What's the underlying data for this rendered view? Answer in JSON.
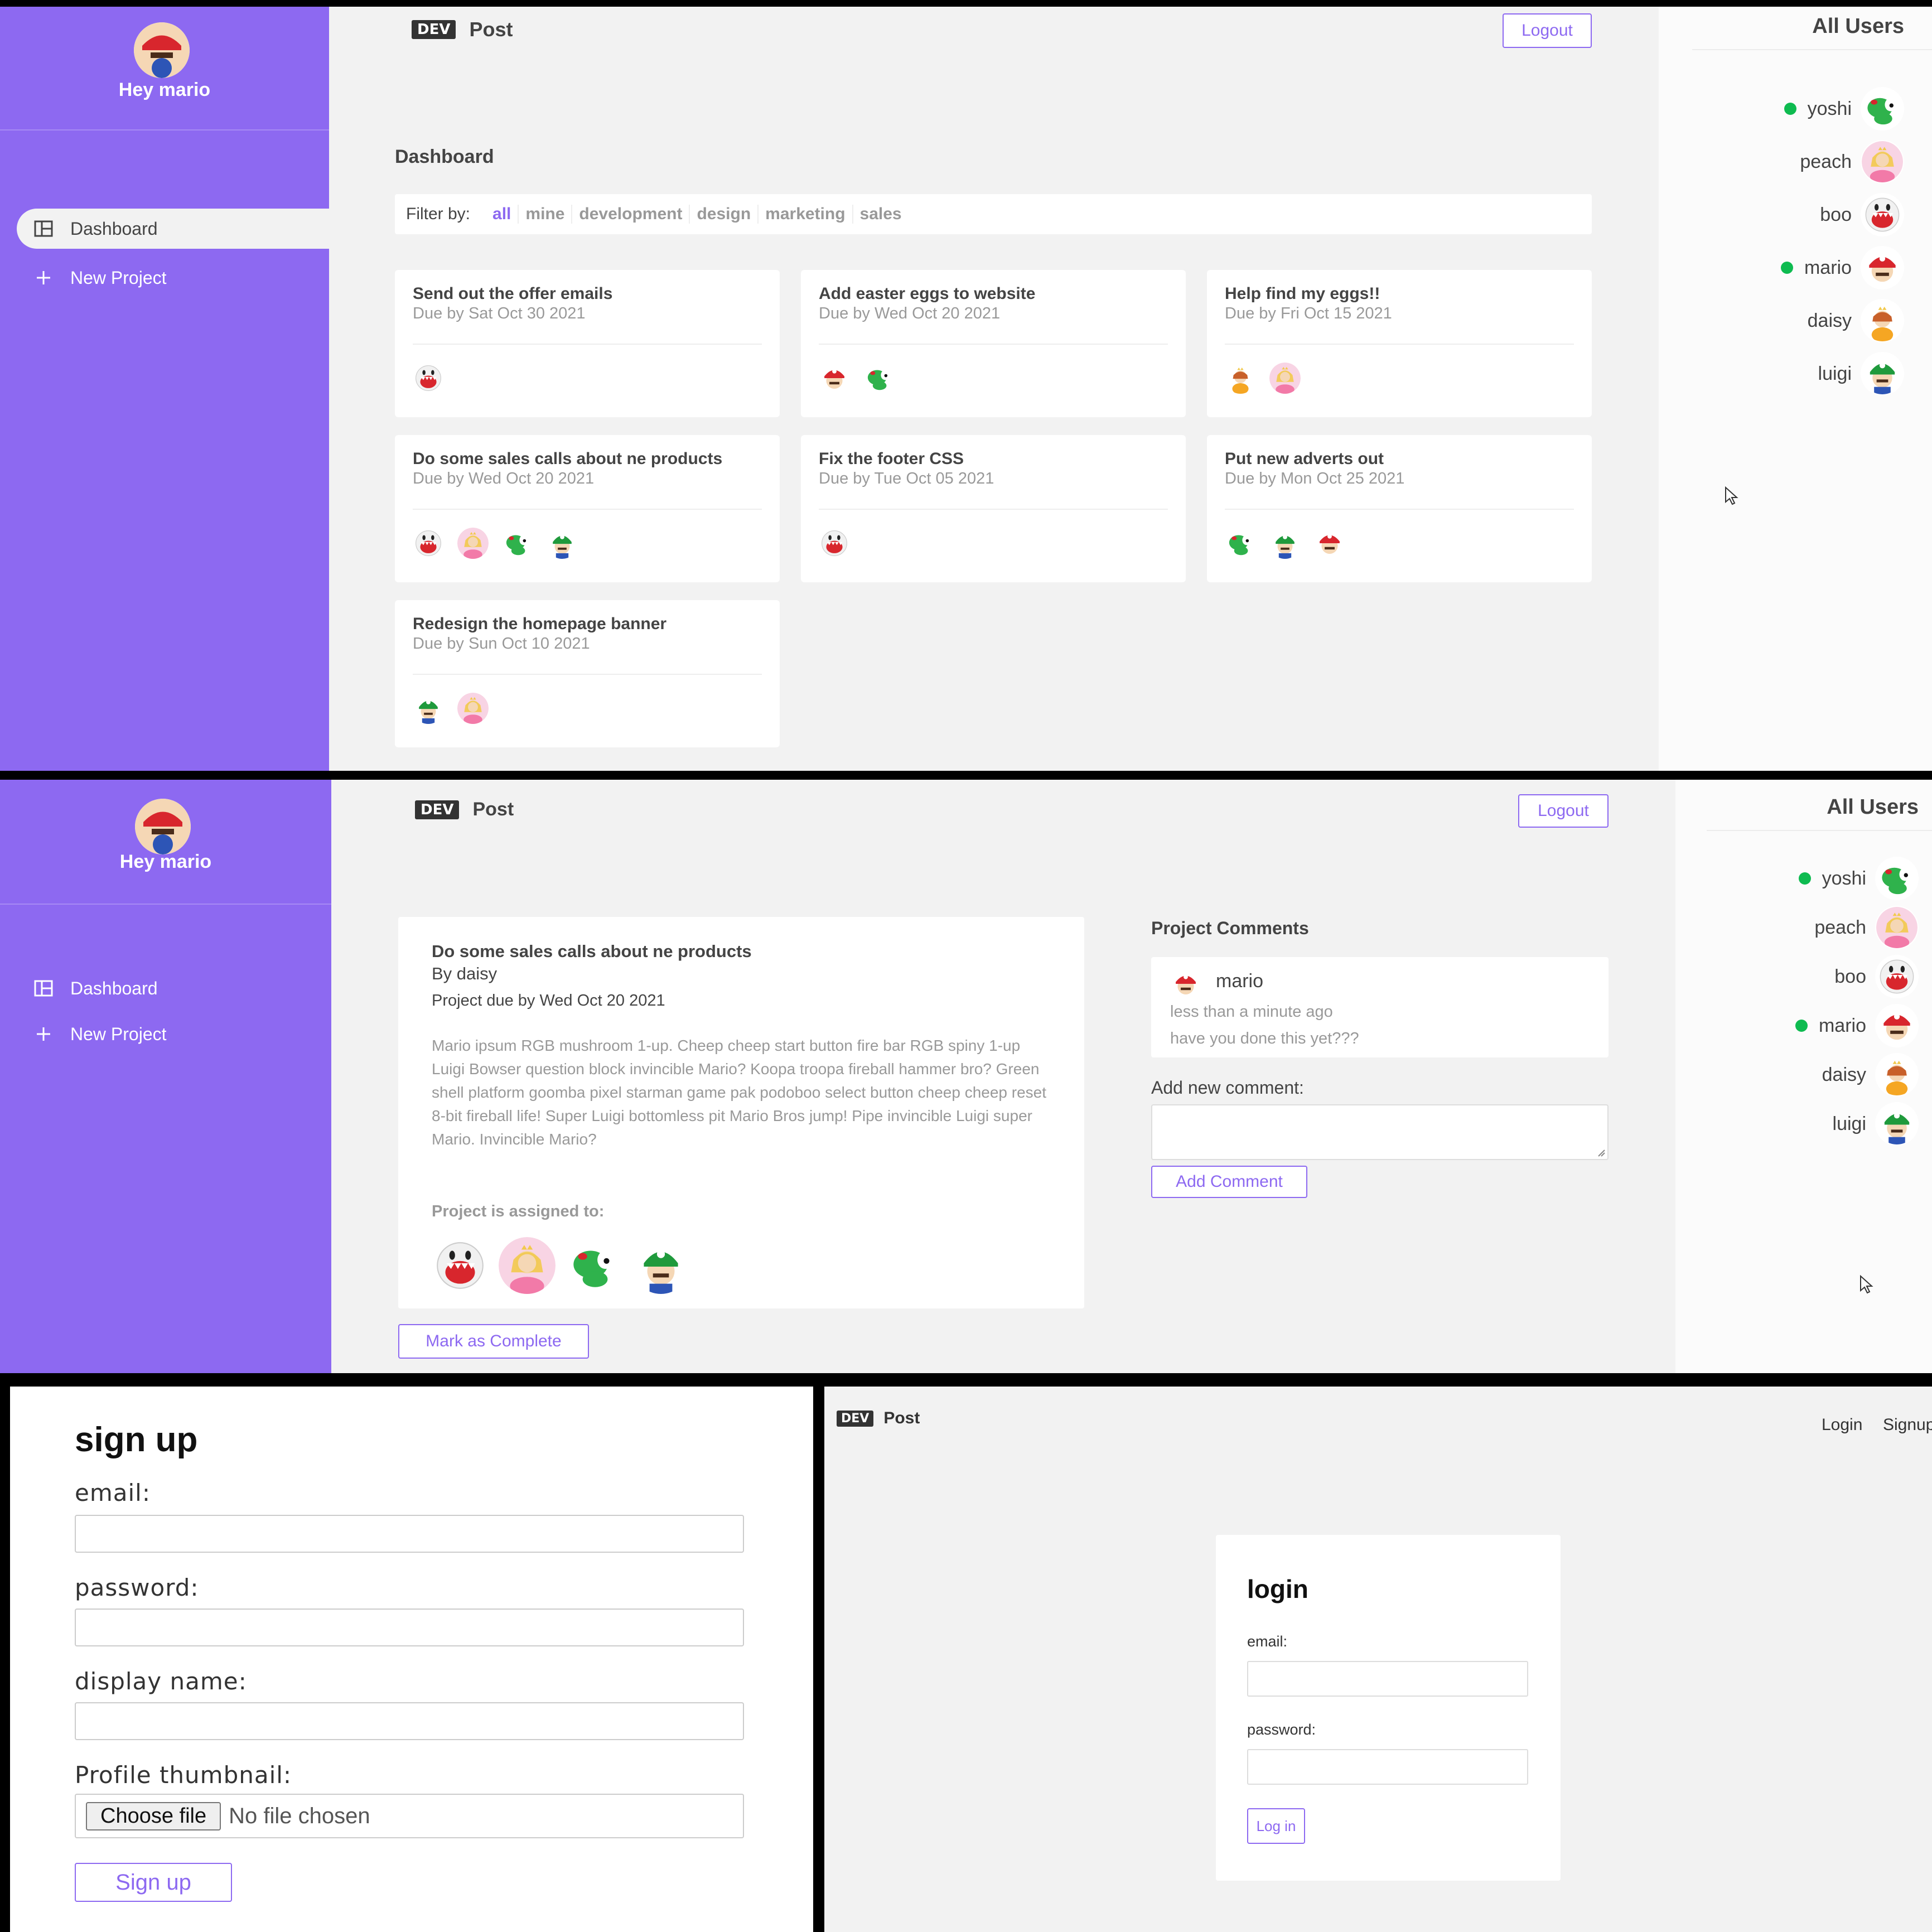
{
  "brand": {
    "badge": "DEV",
    "name": "Post"
  },
  "sidebar": {
    "greeting": "Hey mario",
    "nav": [
      {
        "label": "Dashboard"
      },
      {
        "label": "New Project"
      }
    ]
  },
  "header": {
    "logout_label": "Logout"
  },
  "users": {
    "title": "All Users",
    "list": [
      {
        "name": "yoshi",
        "online": true
      },
      {
        "name": "peach",
        "online": false
      },
      {
        "name": "boo",
        "online": false
      },
      {
        "name": "mario",
        "online": true
      },
      {
        "name": "daisy",
        "online": false
      },
      {
        "name": "luigi",
        "online": false
      }
    ]
  },
  "dashboard": {
    "title": "Dashboard",
    "filter_label": "Filter by:",
    "filters": [
      "all",
      "mine",
      "development",
      "design",
      "marketing",
      "sales"
    ],
    "active_filter": "all",
    "projects": [
      {
        "title": "Send out the offer emails",
        "due": "Due by Sat Oct 30 2021",
        "assigned": [
          "boo"
        ]
      },
      {
        "title": "Add easter eggs to website",
        "due": "Due by Wed Oct 20 2021",
        "assigned": [
          "mario",
          "yoshi"
        ]
      },
      {
        "title": "Help find my eggs!!",
        "due": "Due by Fri Oct 15 2021",
        "assigned": [
          "daisy",
          "peach"
        ]
      },
      {
        "title": "Do some sales calls about ne products",
        "due": "Due by Wed Oct 20 2021",
        "assigned": [
          "boo",
          "peach",
          "yoshi",
          "luigi"
        ]
      },
      {
        "title": "Fix the footer CSS",
        "due": "Due by Tue Oct 05 2021",
        "assigned": [
          "boo"
        ]
      },
      {
        "title": "Put new adverts out",
        "due": "Due by Mon Oct 25 2021",
        "assigned": [
          "yoshi",
          "luigi",
          "mario"
        ]
      },
      {
        "title": "Redesign the homepage banner",
        "due": "Due by Sun Oct 10 2021",
        "assigned": [
          "luigi",
          "peach"
        ]
      }
    ]
  },
  "project_detail": {
    "title": "Do some sales calls about ne products",
    "author": "By daisy",
    "due": "Project due by Wed Oct 20 2021",
    "body": "Mario ipsum RGB mushroom 1-up. Cheep cheep start button fire bar RGB spiny 1-up Luigi Bowser question block invincible Mario? Koopa troopa fireball hammer bro? Green shell platform goomba pixel starman game pak podoboo select button cheep cheep reset 8-bit fireball life! Super Luigi bottomless pit Mario Bros jump! Pipe invincible Luigi super Mario. Invincible Mario?",
    "assigned_label": "Project is assigned to:",
    "assigned": [
      "boo",
      "peach",
      "yoshi",
      "luigi"
    ],
    "complete_label": "Mark as Complete"
  },
  "comments": {
    "title": "Project Comments",
    "list": [
      {
        "author": "mario",
        "time": "less than a minute ago",
        "text": "have you done this yet???"
      }
    ],
    "add_label": "Add new comment:",
    "add_button": "Add Comment"
  },
  "signup": {
    "title": "sign up",
    "email_label": "email:",
    "password_label": "password:",
    "display_label": "display name:",
    "thumb_label": "Profile thumbnail:",
    "file_button": "Choose file",
    "file_status": "No file chosen",
    "submit": "Sign up"
  },
  "login": {
    "title": "login",
    "email_label": "email:",
    "password_label": "password:",
    "submit": "Log in",
    "nav_login": "Login",
    "nav_signup": "Signup"
  },
  "colors": {
    "primary": "#8d69f1",
    "background": "#f2f2f2",
    "online": "#0ebb50",
    "heading": "#444444",
    "muted": "#999999"
  }
}
